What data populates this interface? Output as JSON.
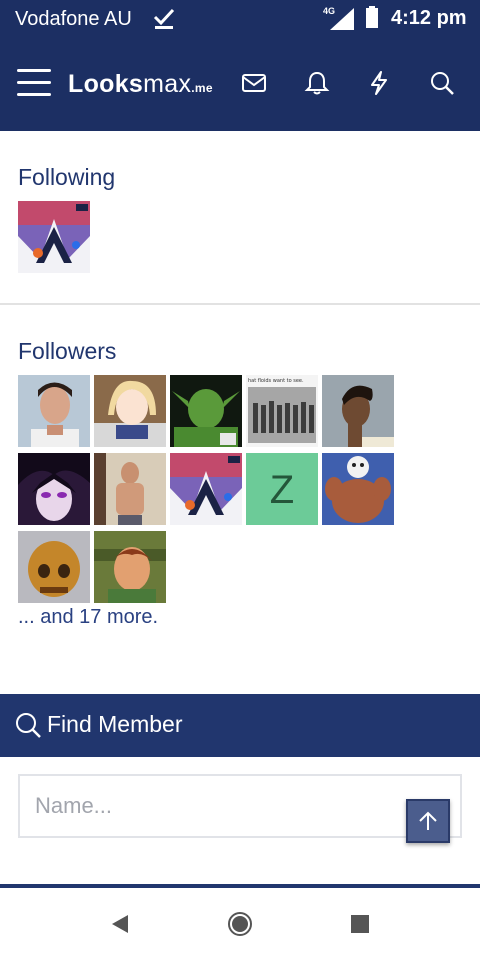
{
  "status_bar": {
    "carrier": "Vodafone AU",
    "network": "4G",
    "time": "4:12 pm",
    "icons": [
      "checkmark-icon",
      "signal-icon",
      "battery-icon"
    ]
  },
  "header": {
    "logo": {
      "part1": "Looks",
      "part2": "max",
      "part3": ".me"
    },
    "icons": [
      "menu-icon",
      "inbox-icon",
      "bell-icon",
      "bolt-icon",
      "search-icon"
    ]
  },
  "following": {
    "title": "Following",
    "avatars": [
      {
        "kind": "anime-collage"
      }
    ]
  },
  "followers": {
    "title": "Followers",
    "avatars": [
      {
        "kind": "man-portrait"
      },
      {
        "kind": "anime-girl"
      },
      {
        "kind": "goblin"
      },
      {
        "kind": "group-photo",
        "caption": "hat floids want to see."
      },
      {
        "kind": "profile-man"
      },
      {
        "kind": "anime-dark"
      },
      {
        "kind": "selfie"
      },
      {
        "kind": "anime-collage"
      },
      {
        "kind": "letter",
        "letter": "Z",
        "color": "#6ccb98"
      },
      {
        "kind": "bodybuilder"
      },
      {
        "kind": "skull"
      },
      {
        "kind": "cartoon"
      }
    ],
    "more_text": "... and 17 more."
  },
  "find_member": {
    "title": "Find Member",
    "placeholder": "Name..."
  },
  "nav": {
    "icons": [
      "back-icon",
      "home-icon",
      "recents-icon"
    ]
  },
  "colors": {
    "header_bg": "#1c2f63",
    "section_title": "#21366e",
    "link": "#2a4182",
    "letter_avatar": "#6ccb98"
  }
}
